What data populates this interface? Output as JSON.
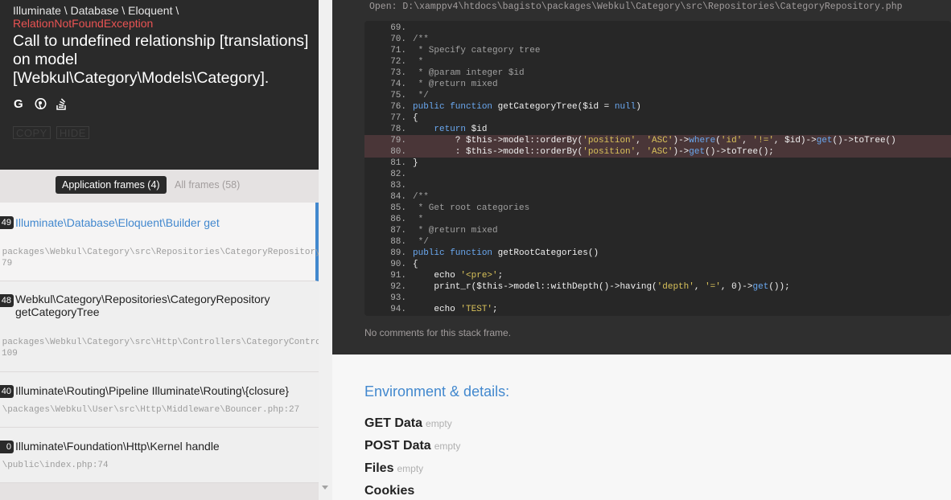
{
  "exception": {
    "class_path": "Illuminate \\ Database \\ Eloquent \\",
    "name": "RelationNotFoundException",
    "message": "Call to undefined relationship [translations] on model [Webkul\\Category\\Models\\Category]."
  },
  "search_icons": [
    "google-icon",
    "duckduckgo-icon",
    "stackoverflow-icon"
  ],
  "buttons": {
    "copy": "COPY",
    "hide": "HIDE"
  },
  "filter": {
    "application": "Application frames (4)",
    "all": "All frames (58)"
  },
  "frames": [
    {
      "index": "49",
      "class": "Illuminate\\Database\\Eloquent\\Builder get",
      "file": ".packages\\Webkul\\Category\\src\\Repositories\\CategoryRepository",
      "line": "79"
    },
    {
      "index": "48",
      "class": "Webkul\\Category\\Repositories\\CategoryRepository getCategoryTree",
      "file": ".packages\\Webkul\\Category\\src\\Http\\Controllers\\CategoryContro",
      "line": "109"
    },
    {
      "index": "40",
      "class": "Illuminate\\Routing\\Pipeline Illuminate\\Routing\\{closure}",
      "file": ".\\packages\\Webkul\\User\\src\\Http\\Middleware\\Bouncer.php:27",
      "line": ""
    },
    {
      "index": "0",
      "class": "Illuminate\\Foundation\\Http\\Kernel handle",
      "file": ".\\public\\index.php:74",
      "line": ""
    }
  ],
  "open_path": "Open: D:\\xamppv4\\htdocs\\bagisto\\packages\\Webkul\\Category\\src\\Repositories\\CategoryRepository.php",
  "code_lines": [
    "69.",
    "70.",
    "71.",
    "72.",
    "73.",
    "74.",
    "75.",
    "76.",
    "77.",
    "78.",
    "79.",
    "80.",
    "81.",
    "82.",
    "83.",
    "84.",
    "85.",
    "86.",
    "87.",
    "88.",
    "89.",
    "90.",
    "91.",
    "92.",
    "93.",
    "94."
  ],
  "no_comments": "No comments for this stack frame.",
  "environment": {
    "title": "Environment & details:",
    "items": [
      {
        "label": "GET Data",
        "status": "empty"
      },
      {
        "label": "POST Data",
        "status": "empty"
      },
      {
        "label": "Files",
        "status": "empty"
      },
      {
        "label": "Cookies",
        "status": ""
      }
    ]
  }
}
